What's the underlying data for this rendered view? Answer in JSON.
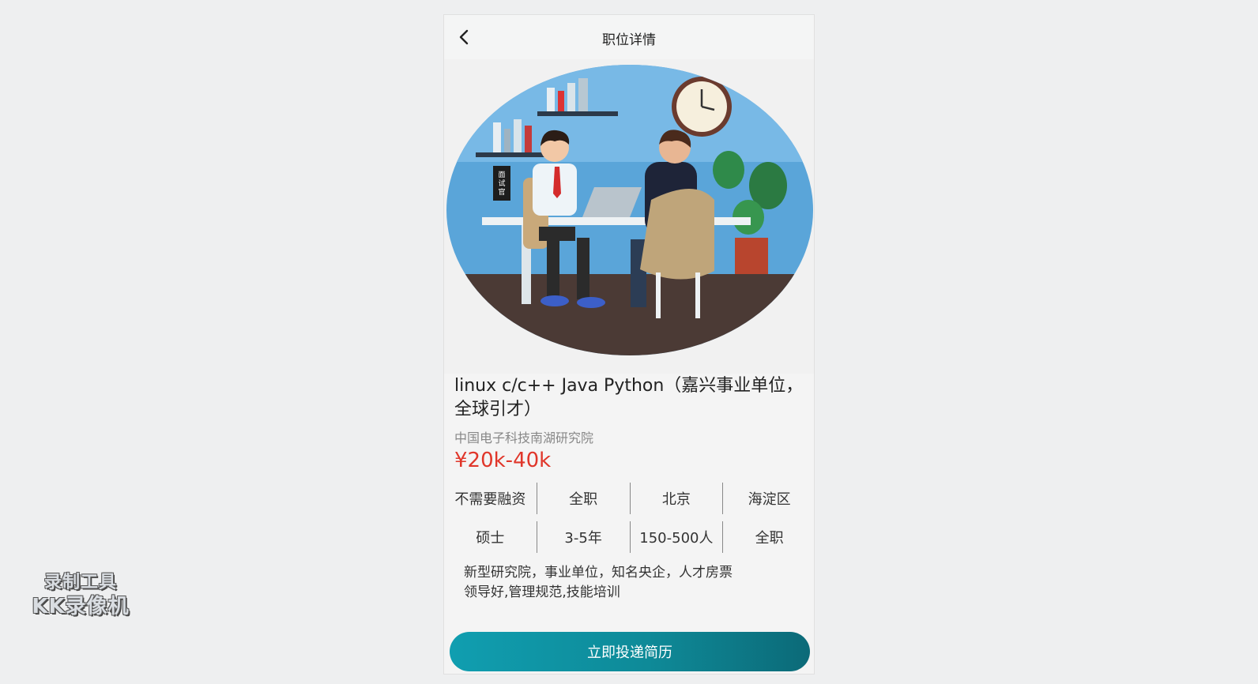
{
  "navbar": {
    "title": "职位详情",
    "back_icon": "chevron-left-icon"
  },
  "job": {
    "title": "linux c/c++ Java Python（嘉兴事业单位，全球引才）",
    "company": "中国电子科技南湖研究院",
    "salary": "¥20k-40k",
    "tags_row1": [
      "不需要融资",
      "全职",
      "北京",
      "海淀区"
    ],
    "tags_row2": [
      "硕士",
      "3-5年",
      "150-500人",
      "全职"
    ],
    "desc_line1": "新型研究院，事业单位，知名央企，人才房票",
    "desc_line2": "领导好,管理规范,技能培训"
  },
  "apply_button": {
    "label": "立即投递简历"
  },
  "illustration": {
    "sign_text": "面试官"
  },
  "watermark": {
    "line1": "录制工具",
    "line2": "KK录像机"
  },
  "colors": {
    "salary": "#e0362a",
    "button_start": "#109eb0",
    "button_end": "#0c6a78"
  }
}
